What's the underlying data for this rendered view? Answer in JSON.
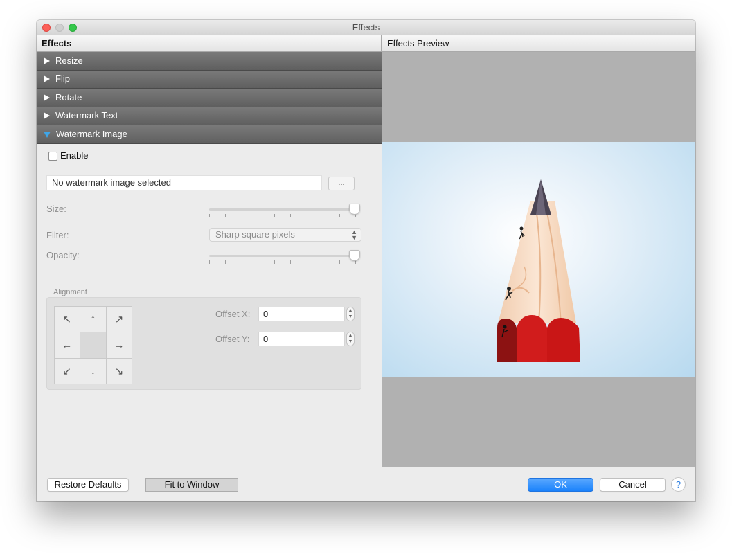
{
  "window": {
    "title": "Effects"
  },
  "headers": {
    "left": "Effects",
    "right": "Effects Preview"
  },
  "sections": [
    {
      "label": "Resize",
      "expanded": false
    },
    {
      "label": "Flip",
      "expanded": false
    },
    {
      "label": "Rotate",
      "expanded": false
    },
    {
      "label": "Watermark Text",
      "expanded": false
    },
    {
      "label": "Watermark Image",
      "expanded": true
    }
  ],
  "watermark_image": {
    "enable_label": "Enable",
    "enabled": false,
    "file_value": "No watermark image selected",
    "browse_label": "...",
    "size_label": "Size:",
    "size_value": 1.0,
    "filter_label": "Filter:",
    "filter_value": "Sharp square pixels",
    "opacity_label": "Opacity:",
    "opacity_value": 1.0,
    "alignment_label": "Alignment",
    "offset_x_label": "Offset X:",
    "offset_x_value": "0",
    "offset_y_label": "Offset Y:",
    "offset_y_value": "0"
  },
  "alignment_icons": [
    "arrow-up-left-icon",
    "arrow-up-icon",
    "arrow-up-right-icon",
    "arrow-left-icon",
    "center-icon",
    "arrow-right-icon",
    "arrow-down-left-icon",
    "arrow-down-icon",
    "arrow-down-right-icon"
  ],
  "buttons": {
    "restore": "Restore Defaults",
    "fit": "Fit to Window",
    "ok": "OK",
    "cancel": "Cancel",
    "help": "?"
  },
  "colors": {
    "ok_button": "#1a82fb",
    "section_bar": "#666666",
    "expanded_triangle": "#3fa6e8",
    "preview_bg": "#b1b1b1"
  }
}
